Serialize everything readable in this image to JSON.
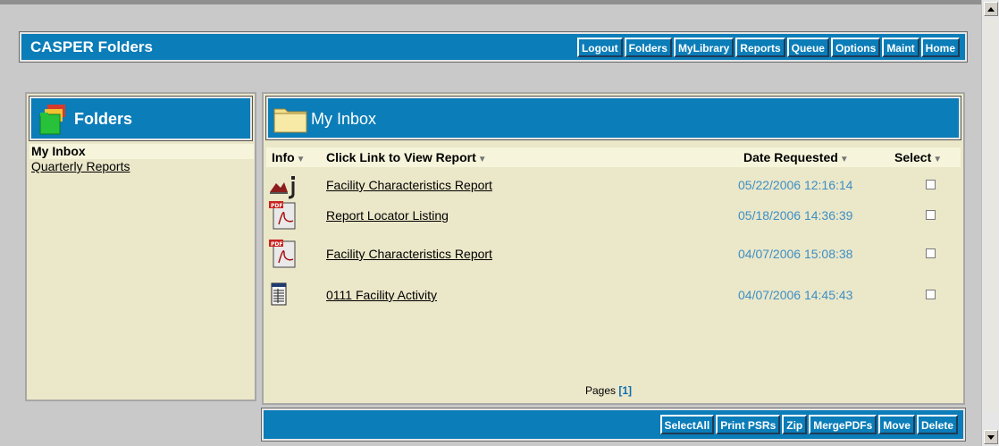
{
  "app": {
    "title": "CASPER Folders"
  },
  "nav": {
    "buttons": [
      "Logout",
      "Folders",
      "MyLibrary",
      "Reports",
      "Queue",
      "Options",
      "Maint",
      "Home"
    ]
  },
  "sidebar": {
    "title": "Folders",
    "items": [
      {
        "label": "My Inbox",
        "active": true
      },
      {
        "label": "Quarterly Reports",
        "active": false
      }
    ]
  },
  "inbox": {
    "title": "My Inbox",
    "columns": {
      "info": "Info",
      "report": "Click Link to View Report",
      "date": "Date Requested",
      "select": "Select"
    },
    "rows": [
      {
        "icon": "report-viewer-icon",
        "report": "Facility Characteristics Report",
        "date": "05/22/2006 12:16:14",
        "selected": false
      },
      {
        "icon": "pdf-icon",
        "report": "Report Locator Listing",
        "date": "05/18/2006 14:36:39",
        "selected": false
      },
      {
        "icon": "pdf-icon",
        "report": "Facility Characteristics Report",
        "date": "04/07/2006 15:08:38",
        "selected": false
      },
      {
        "icon": "spreadsheet-icon",
        "report": "0111 Facility Activity",
        "date": "04/07/2006 14:45:43",
        "selected": false
      }
    ],
    "pager": {
      "label": "Pages",
      "current": "[1]"
    }
  },
  "actions": {
    "buttons": [
      "SelectAll",
      "Print PSRs",
      "Zip",
      "MergePDFs",
      "Move",
      "Delete"
    ]
  },
  "colors": {
    "bar_blue": "#0b7db8",
    "panel_bg": "#ebe7c9",
    "date_blue": "#3d8fc4",
    "page_bg": "#c9c9c9"
  }
}
